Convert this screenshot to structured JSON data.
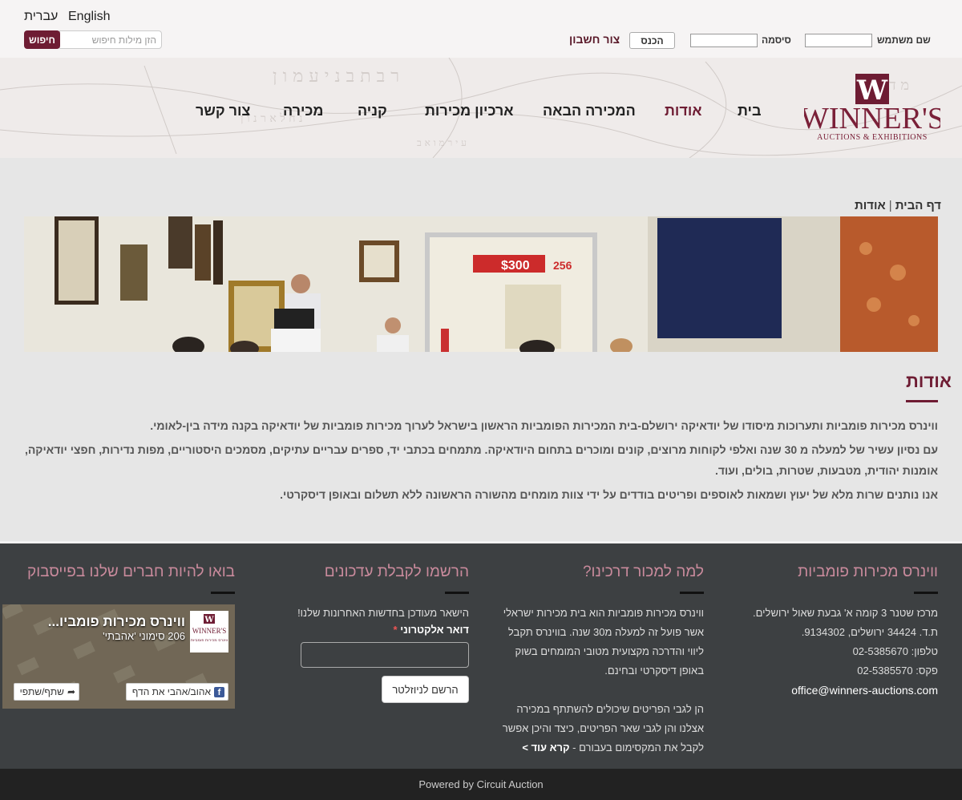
{
  "topbar": {
    "lang_en": "English",
    "lang_he": "עברית",
    "search_button": "חיפוש",
    "search_placeholder": "הזן מילות חיפוש",
    "signup": "צור חשבון",
    "login": "הכנס",
    "password_label": "סיסמה",
    "username_label": "שם משתמש"
  },
  "nav": {
    "items": [
      "בית",
      "אודות",
      "המכירה הבאה",
      "ארכיון מכירות",
      "קניה",
      "מכירה",
      "צור קשר"
    ],
    "active_index": 1
  },
  "logo": {
    "initial": "W",
    "name": "WINNER'S",
    "tagline": "AUCTIONS & EXHIBITIONS"
  },
  "breadcrumb": {
    "home": "דף הבית",
    "current": "אודות"
  },
  "banner": {
    "screen_price": "$300",
    "screen_lot": "256"
  },
  "content": {
    "title": "אודות",
    "paragraphs": [
      "ווינרס מכירות פומביות ותערוכות מיסודו של יודאיקה ירושלם-בית המכירות הפומביות הראשון בישראל לערוך מכירות פומביות של יודאיקה בקנה מידה בין-לאומי.",
      "עם נסיון עשיר של למעלה מ 30 שנה ואלפי לקוחות מרוצים, קונים ומוכרים בתחום היודאיקה. מתמחים בכתבי יד, ספרים עבריים עתיקים, מסמכים היסטוריים, מפות נדירות, חפצי יודאיקה, אומנות יהודית, מטבעות, שטרות, בולים, ועוד.",
      "אנו נותנים שרות מלא של יעוץ ושמאות לאוספים ופריטים בודדים על ידי צוות מומחים מהשורה הראשונה ללא תשלום ובאופן דיסקרטי."
    ]
  },
  "footer": {
    "col1": {
      "heading": "ווינרס מכירות פומביות",
      "address": "מרכז שטנר 3 קומה א' גבעת שאול ירושלים.",
      "pobox": "ת.ד. 34424 ירושלים, 9134302.",
      "phone": "טלפון: 02-5385670",
      "fax": "פקס: 02-5385570",
      "email": "office@winners-auctions.com"
    },
    "col2": {
      "heading": "למה למכור דרכינו?",
      "p1": "ווינרס מכירות פומביות הוא בית מכירות ישראלי אשר פועל זה למעלה מ30 שנה. בווינרס תקבל ליווי והדרכה מקצועית מטובי המומחים בשוק באופן דיסקרטי ובחינם.",
      "p2": "הן לגבי הפריטים שיכולים להשתתף במכירה אצלנו והן לגבי שאר הפריטים, כיצד והיכן אפשר לקבל את המקסימום בעבורם - ",
      "read_more": "קרא עוד >"
    },
    "col3": {
      "heading": "הרשמו לקבלת עדכונים",
      "text": "הישאר מעודכן בחדשות האחרונות שלנו!",
      "email_label": "דואר אלקטרוני",
      "required_mark": "*",
      "button": "הרשם לניוזלטר"
    },
    "col4": {
      "heading": "בואו להיות חברים שלנו בפייסבוק",
      "fb_title": "ווינרס מכירות פומביו...",
      "fb_count": "206 סימוני 'אהבתי'",
      "fb_like": "אהוב/אהבי את הדף",
      "fb_share": "שתף/שתפי",
      "fb_logo_name": "WINNER'S",
      "fb_logo_sub": "ווינרס מכירות פומביות"
    }
  },
  "powered": "Powered by Circuit Auction",
  "colors": {
    "brand": "#6e1c33",
    "footer_bg": "#3d4042",
    "footer_heading": "#c98a9c"
  }
}
